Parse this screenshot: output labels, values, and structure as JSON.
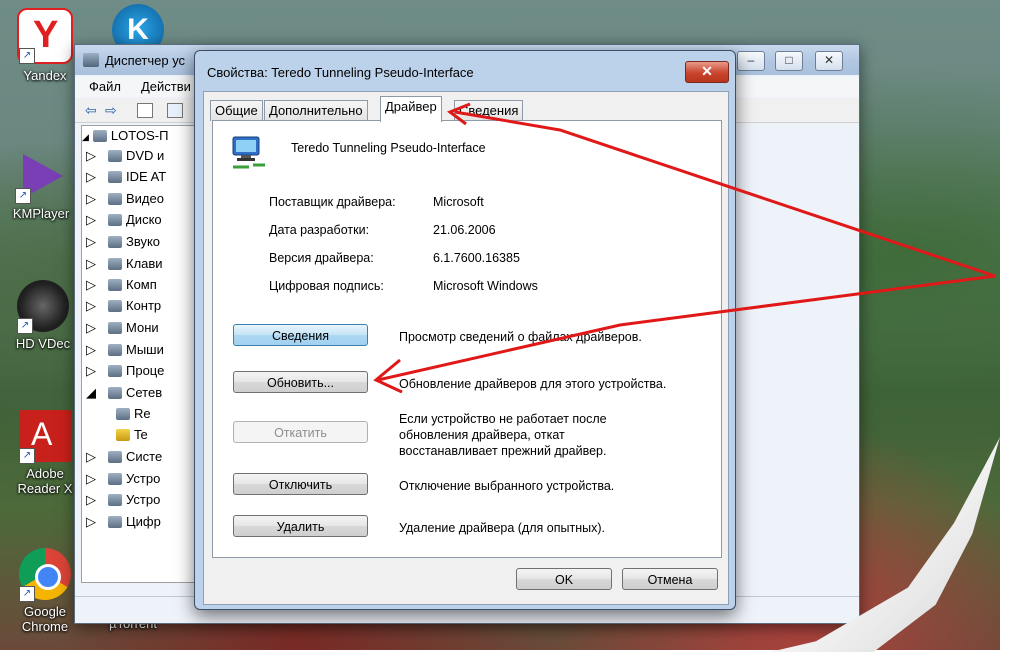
{
  "desktop": {
    "icons": [
      {
        "label": "Yandex",
        "color": "#e02020"
      },
      {
        "label": "KMPlayer",
        "color": "#7a3fb5"
      },
      {
        "label": "HD VDec",
        "color": "#2a2a2a"
      },
      {
        "label": "Adobe Reader X",
        "color": "#c8201b"
      },
      {
        "label": "Google Chrome",
        "color": "#2f9e41"
      },
      {
        "label": "µTorrent",
        "color": "#3a7d2b"
      }
    ]
  },
  "device_manager": {
    "title": "Диспетчер ус",
    "menu": [
      "Файл",
      "Действи"
    ],
    "tree": [
      "LOTOS-П",
      "DVD и",
      "IDE AT",
      "Видео",
      "Диско",
      "Звуко",
      "Клави",
      "Комп",
      "Контр",
      "Мони",
      "Мыши",
      "Проце",
      "Сетев",
      "Re",
      "Te",
      "Систе",
      "Устро",
      "Устро",
      "Цифр"
    ]
  },
  "dialog": {
    "title": "Свойства: Teredo Tunneling Pseudo-Interface",
    "close_glyph": "✕",
    "tabs": [
      "Общие",
      "Дополнительно",
      "Драйвер",
      "Сведения"
    ],
    "device_name": "Teredo Tunneling Pseudo-Interface",
    "props": [
      {
        "label": "Поставщик драйвера:",
        "value": "Microsoft"
      },
      {
        "label": "Дата разработки:",
        "value": "21.06.2006"
      },
      {
        "label": "Версия драйвера:",
        "value": "6.1.7600.16385"
      },
      {
        "label": "Цифровая подпись:",
        "value": "Microsoft Windows"
      }
    ],
    "actions": [
      {
        "button": "Сведения",
        "desc": "Просмотр сведений о файлах драйверов."
      },
      {
        "button": "Обновить...",
        "desc": "Обновление драйверов для этого устройства."
      },
      {
        "button": "Откатить",
        "desc": "Если устройство не работает после обновления драйвера, откат восстанавливает прежний драйвер."
      },
      {
        "button": "Отключить",
        "desc": "Отключение выбранного устройства."
      },
      {
        "button": "Удалить",
        "desc": "Удаление драйвера (для опытных)."
      }
    ],
    "ok": "OK",
    "cancel": "Отмена"
  },
  "colors": {
    "accent_arrow": "#e01818"
  }
}
